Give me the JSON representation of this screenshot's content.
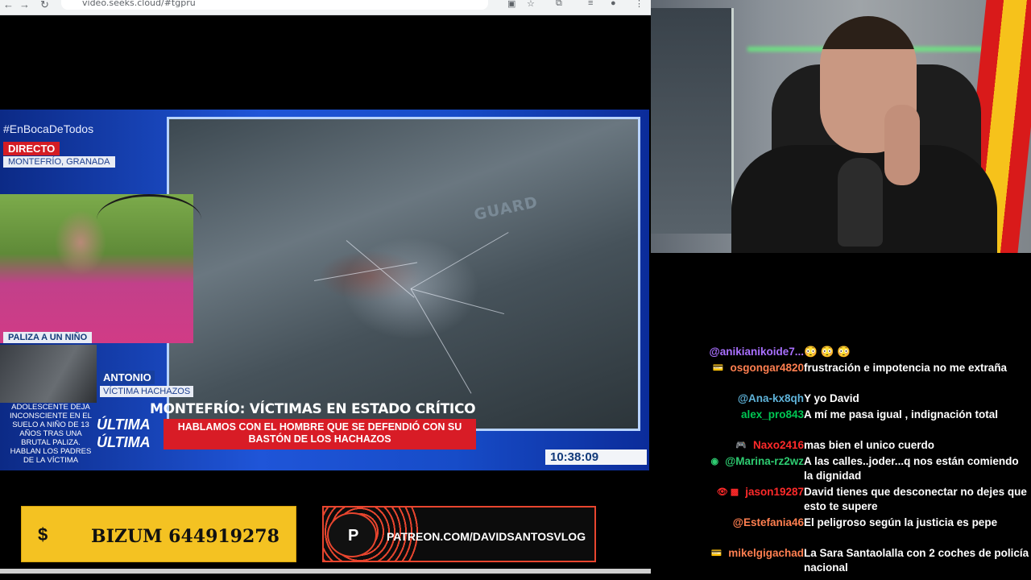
{
  "browser": {
    "url": "video.seeks.cloud/#tgpru",
    "back": "←",
    "forward": "→",
    "reload": "↻"
  },
  "video": {
    "hashtag": "#EnBocaDeTodos",
    "live": "DIRECTO",
    "location": "MONTEFRÍO, GRANADA",
    "sidebar_tag": "PALIZA A UN NIÑO",
    "sidebar_story": "ADOLESCENTE DEJA INCONSCIENTE EN EL SUELO A NIÑO DE 13 AÑOS TRAS UNA BRUTAL PALIZA. HABLAN LOS PADRES DE LA VÍCTIMA",
    "guest_name": "ANTONIO",
    "guest_role": "VÍCTIMA HACHAZOS",
    "ultima": "ÚLTIMA",
    "vehicle_text": "GUARD",
    "headline": "MONTEFRÍO: VÍCTIMAS EN ESTADO CRÍTICO",
    "subheadline": "HABLAMOS CON EL HOMBRE QUE SE DEFENDIÓ CON SU BASTÓN DE LOS HACHAZOS",
    "clock": "10:38:09"
  },
  "donations": {
    "bizum_icon": "$",
    "bizum": "BIZUM 644919278",
    "patreon_icon": "P",
    "patreon": "PATREON.COM/DAVIDSANTOSVLOG"
  },
  "chat": [
    {
      "user": "@anikianikoide7...",
      "color": "#a970ff",
      "msg": "😳 😳 😳",
      "badge": ""
    },
    {
      "user": "osgongar4820",
      "color": "#ff7f50",
      "msg": "frustración e impotencia no me extraña",
      "badge": "💳"
    },
    {
      "user": "@Ana-kx8qh",
      "color": "#5fb3d9",
      "msg": "Y yo David",
      "badge": ""
    },
    {
      "user": "alex_pro843",
      "color": "#00c853",
      "msg": "A mí me pasa igual , indignación total",
      "badge": ""
    },
    {
      "user": "Naxo2416",
      "color": "#ff2a2a",
      "msg": "mas bien el unico cuerdo",
      "badge": "🎮"
    },
    {
      "user": "@Marina-rz2wz",
      "color": "#2ecc71",
      "msg": "A las calles..joder...q nos están comiendo la dignidad",
      "badge": "◉"
    },
    {
      "user": "jason19287",
      "color": "#ff2a2a",
      "msg": "David tienes que desconectar no dejes que esto te supere",
      "badge": "👁 ▩"
    },
    {
      "user": "@Estefania46",
      "color": "#ff7f50",
      "msg": "El peligroso según la justicia es pepe",
      "badge": ""
    },
    {
      "user": "mikelgigachad",
      "color": "#ff7f50",
      "msg": "La Sara Santaolalla con 2 coches de policía nacional",
      "badge": "💳"
    }
  ]
}
